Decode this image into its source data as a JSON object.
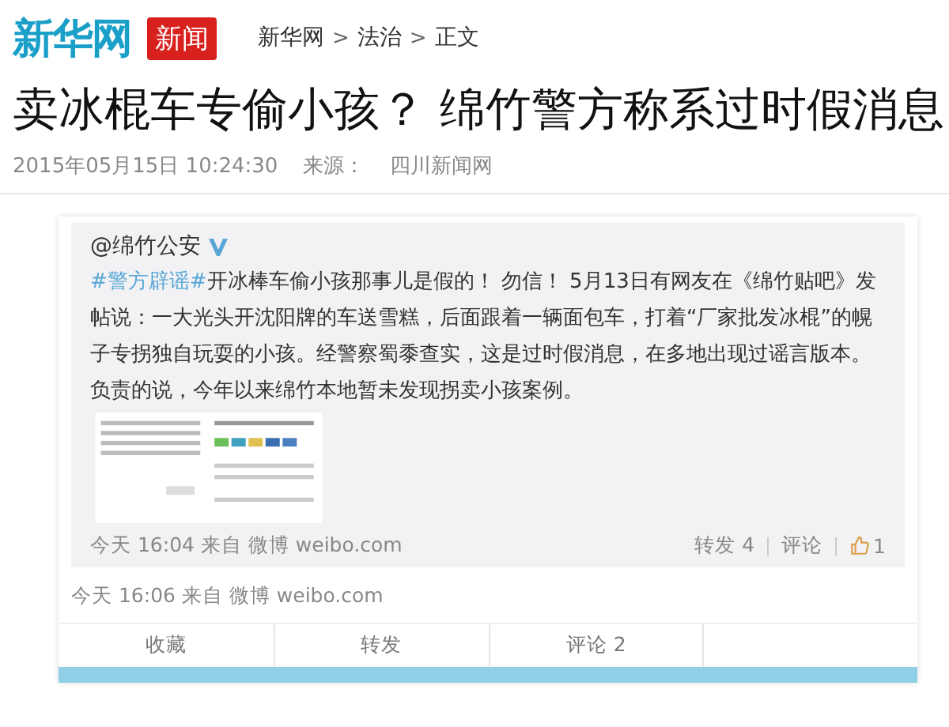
{
  "header": {
    "logo": "新华网",
    "badge": "新闻",
    "breadcrumb": [
      "新华网",
      "法治",
      "正文"
    ],
    "separator": ">"
  },
  "article": {
    "title": "卖冰棍车专偷小孩？ 绵竹警方称系过时假消息",
    "date": "2015年05月15日 10:24:30",
    "source_label": "来源：",
    "source": "四川新闻网"
  },
  "post": {
    "repost": {
      "user": "@绵竹公安",
      "verified": true,
      "hashtag": "#警方辟谣#",
      "text": "开冰棒车偷小孩那事儿是假的！ 勿信！ 5月13日有网友在《绵竹贴吧》发帖说：一大光头开沈阳牌的车送雪糕，后面跟着一辆面包车，打着“厂家批发冰棍”的幌子专拐独自玩耍的小孩。经警察蜀黍查实，这是过时假消息，在多地出现过谣言版本。负责的说，今年以来绵竹本地暂未发现拐卖小孩案例。",
      "time": "今天 16:04 来自 微博 weibo.com",
      "actions": [
        {
          "kind": "text",
          "label": "转发 4"
        },
        {
          "kind": "text",
          "label": "评论"
        },
        {
          "kind": "like",
          "label": "1"
        }
      ]
    },
    "time": "今天 16:06 来自 微博 weibo.com",
    "actions": [
      "收藏",
      "转发",
      "评论 2"
    ]
  }
}
